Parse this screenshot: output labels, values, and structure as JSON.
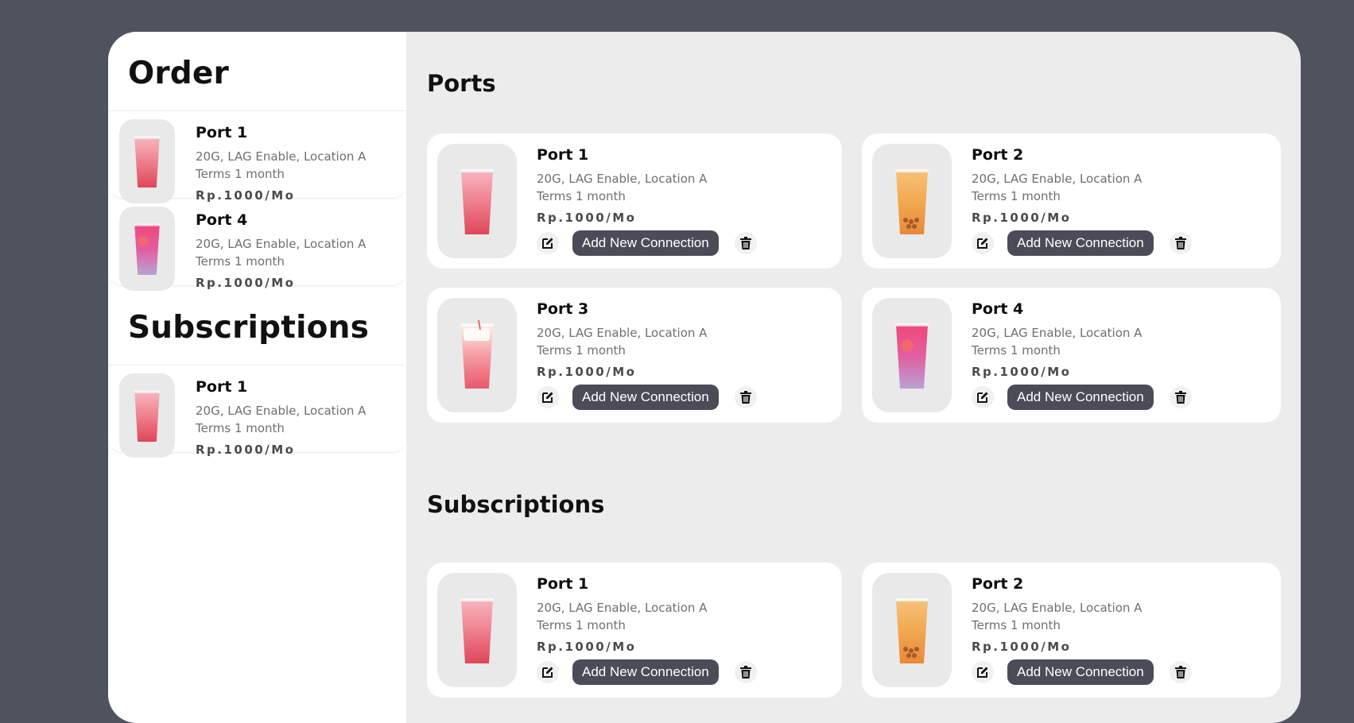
{
  "sidebar": {
    "order_title": "Order",
    "order_items": [
      {
        "name": "Port 1",
        "desc": "20G, LAG Enable, Location A",
        "terms": "Terms 1 month",
        "price": "Rp.1000/Mo",
        "drink": "pink"
      },
      {
        "name": "Port 4",
        "desc": "20G, LAG Enable, Location A",
        "terms": "Terms 1 month",
        "price": "Rp.1000/Mo",
        "drink": "purple"
      }
    ],
    "subscriptions_title": "Subscriptions",
    "subscription_items": [
      {
        "name": "Port 1",
        "desc": "20G, LAG Enable, Location A",
        "terms": "Terms 1 month",
        "price": "Rp.1000/Mo",
        "drink": "pink"
      }
    ]
  },
  "main": {
    "ports_title": "Ports",
    "ports": [
      {
        "name": "Port 1",
        "desc": "20G, LAG Enable, Location A",
        "terms": "Terms 1 month",
        "price": "Rp.1000/Mo",
        "button": "Add New Connection",
        "drink": "pink"
      },
      {
        "name": "Port 2",
        "desc": "20G, LAG Enable, Location A",
        "terms": "Terms 1 month",
        "price": "Rp.1000/Mo",
        "button": "Add New Connection",
        "drink": "orange"
      },
      {
        "name": "Port 3",
        "desc": "20G, LAG Enable, Location A",
        "terms": "Terms 1 month",
        "price": "Rp.1000/Mo",
        "button": "Add New Connection",
        "drink": "cream"
      },
      {
        "name": "Port 4",
        "desc": "20G, LAG Enable, Location A",
        "terms": "Terms 1 month",
        "price": "Rp.1000/Mo",
        "button": "Add New Connection",
        "drink": "purple"
      }
    ],
    "subscriptions_title": "Subscriptions",
    "subscriptions": [
      {
        "name": "Port 1",
        "desc": "20G, LAG Enable, Location A",
        "terms": "Terms 1 month",
        "price": "Rp.1000/Mo",
        "button": "Add New Connection",
        "drink": "pink"
      },
      {
        "name": "Port 2",
        "desc": "20G, LAG Enable, Location A",
        "terms": "Terms 1 month",
        "price": "Rp.1000/Mo",
        "button": "Add New Connection",
        "drink": "orange"
      }
    ]
  },
  "icons": {
    "edit": "edit-icon",
    "delete": "trash-icon"
  },
  "colors": {
    "background": "#4f535e",
    "panel": "#ececec",
    "button": "#4a4d57"
  }
}
